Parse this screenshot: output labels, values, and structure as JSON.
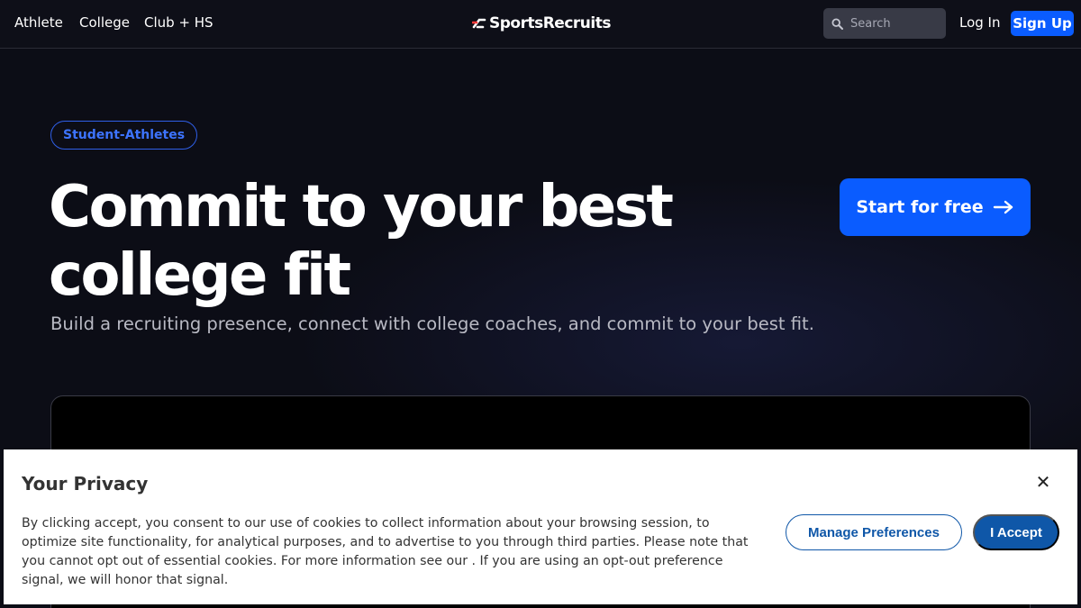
{
  "nav": {
    "links": [
      "Athlete",
      "College",
      "Club + HS"
    ],
    "logo_text": "SportsRecruits",
    "search_placeholder": "Search",
    "login_label": "Log In",
    "signup_label": "Sign Up"
  },
  "hero": {
    "badge": "Student-Athletes",
    "headline_line1": "Commit to your best",
    "headline_line2": "college fit",
    "subhead": "Build a recruiting presence, connect with college coaches, and commit to your best fit.",
    "cta_label": "Start for free"
  },
  "privacy": {
    "title": "Your Privacy",
    "body": "By clicking accept, you consent to our use of cookies to collect information about your browsing session, to optimize site functionality, for analytical purposes, and to advertise to you through third parties. Please note that you cannot opt out of essential cookies. For more information see our . If you are using an opt-out preference signal, we will honor that signal.",
    "manage_label": "Manage Preferences",
    "accept_label": "I Accept",
    "close_glyph": "✕"
  },
  "colors": {
    "accent": "#0a5cff",
    "background": "#0c0d16",
    "privacy_button": "#0f57a8"
  },
  "icons": {
    "search": "search-icon",
    "arrow": "arrow-right-icon",
    "close": "close-icon",
    "logo": "sportsrecruits-logo-icon"
  }
}
